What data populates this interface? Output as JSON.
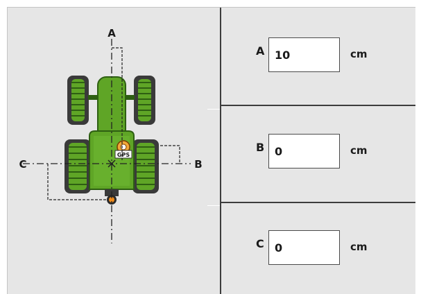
{
  "diagram": {
    "labels": {
      "a": "A",
      "b": "B",
      "c": "C"
    },
    "gps_badge": "GPS"
  },
  "fields": [
    {
      "label": "A",
      "value": "10",
      "unit": "cm"
    },
    {
      "label": "B",
      "value": "0",
      "unit": "cm"
    },
    {
      "label": "C",
      "value": "0",
      "unit": "cm"
    }
  ],
  "colors": {
    "background": "#e6e6e6",
    "tractor_green": "#5fa526",
    "tractor_dark": "#2e5f12",
    "divider": "#3c3c3c"
  }
}
